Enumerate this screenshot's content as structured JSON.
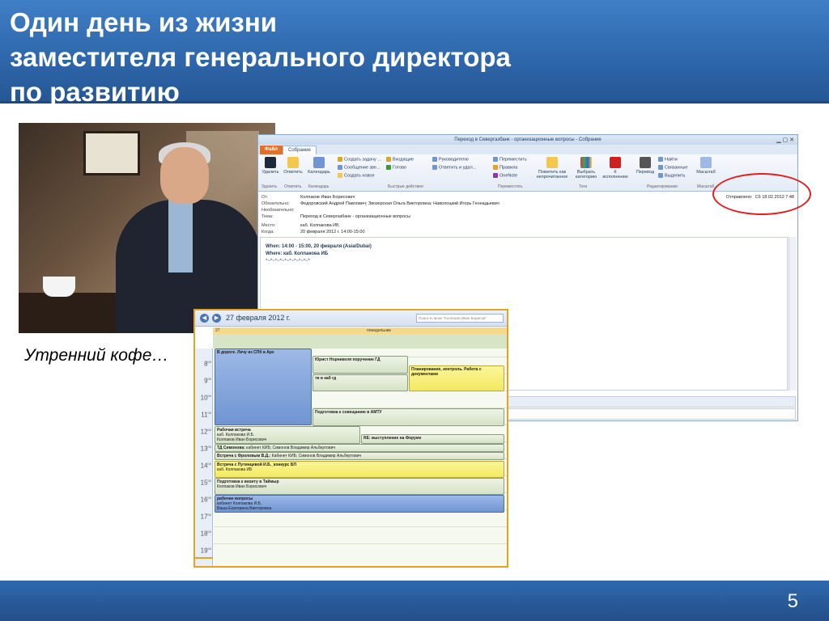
{
  "slide": {
    "title_lines": [
      "Один день из жизни",
      "заместителя генерального директора",
      "по развитию"
    ],
    "caption": "Утренний кофе…",
    "page_number": "5"
  },
  "colors": {
    "header_blue": "#2f68ad",
    "highlight_red": "#e02020",
    "calendar_border": "#e5a321"
  },
  "mail": {
    "window_title": "Переход в Севергазбанк - организационные вопросы - Собрание",
    "tabs": [
      "Файл",
      "Собрание"
    ],
    "ribbon": {
      "delete": "Удалить",
      "reply": "Ответить",
      "calendar": "Календарь",
      "quick": [
        "Создать задачу ...",
        "Сообщение зве...",
        "Создать новое"
      ],
      "quick2": [
        "Входящие",
        "Готово"
      ],
      "quick3": [
        "Руководителю",
        "Ответить и удал..."
      ],
      "move": [
        "Переместить",
        "Правила",
        "OneNote"
      ],
      "mark_unread": "Пометить как непрочитанное",
      "category": "Выбрать категорию",
      "followup": "К исполнению",
      "translate": "Перевод",
      "find": [
        "Найти",
        "Связанные",
        "Выделить"
      ],
      "zoom": "Масштаб",
      "groups": [
        "Удалить",
        "Ответить",
        "Календарь",
        "Быстрые действия",
        "Переместить",
        "Теги",
        "Редактирование",
        "Масштаб"
      ]
    },
    "header": {
      "from_label": "От:",
      "from": "Колпаков Иван Борисович",
      "required_label": "Обязательно:",
      "required": "Федоровский Андрей Павлович; Звозерская Ольга Викторовна; Наволоцкий Игорь Геннадьевич",
      "optional_label": "Необязательно:",
      "subject_label": "Тема:",
      "subject": "Переход в Севергазбанк - организационные вопросы",
      "location_label": "Место:",
      "location": "каб. Колпакова ИБ",
      "when_label": "Когда:",
      "when": "20 февраля 2012 г. 14:00-15:00",
      "sent_label": "Отправлено:",
      "sent": "Сб 18.02.2012 7:48"
    },
    "body": {
      "when_line": "When: 14:00 - 15:00, 20 февраля (Asia/Dubai)",
      "where_line": "Where: каб. Колпакова ИБ",
      "separator": "*~*~*~*~*~*~*~*~*~*"
    }
  },
  "calendar": {
    "date_title": "27 февраля 2012 г.",
    "search_placeholder": "Поиск в папке \"Колпаков Иван Борисов\"",
    "day_number": "27",
    "day_name": "понедельник",
    "hours": [
      "8",
      "9",
      "10",
      "11",
      "12",
      "13",
      "14",
      "15",
      "16",
      "17",
      "18",
      "19"
    ],
    "events": {
      "e1": "В дороге. Лечу из СПб в Арх",
      "e2": "Юрист Норникеля поручение ГД",
      "e3": "тв в каб гд",
      "e4": "Планирование, контроль. Работа с документами",
      "e5": "Подготовка к совещанию в АМТУ",
      "e6_title": "Рабочая встреча",
      "e6_l1": "каб. Колпакова И.Б.",
      "e6_l2": "Колпаков Иван Борисович",
      "e7": "RE: выступление на Форуме",
      "e8_title": "ТД Симонова:",
      "e8_rest": "кабинет КИБ; Симонов Владимир Альбертович",
      "e9_title": "Встреча с Фроловым В.Д.:",
      "e9_rest": "Кабинет КИБ; Симонов Владимир Альбертович",
      "e10_title": "Встреча с Путинцевой И.Б._конкурс БП",
      "e10_l1": "каб. Колпакова ИБ",
      "e11_title": "Подготовка к визиту в Таймыр",
      "e11_l1": "Колпаков Иван Борисович",
      "e12_title": "рабочие вопросы",
      "e12_l1": "кабинет Колпакова И.Б.",
      "e12_l2": "Ваша Екатерина Викторовна"
    }
  }
}
